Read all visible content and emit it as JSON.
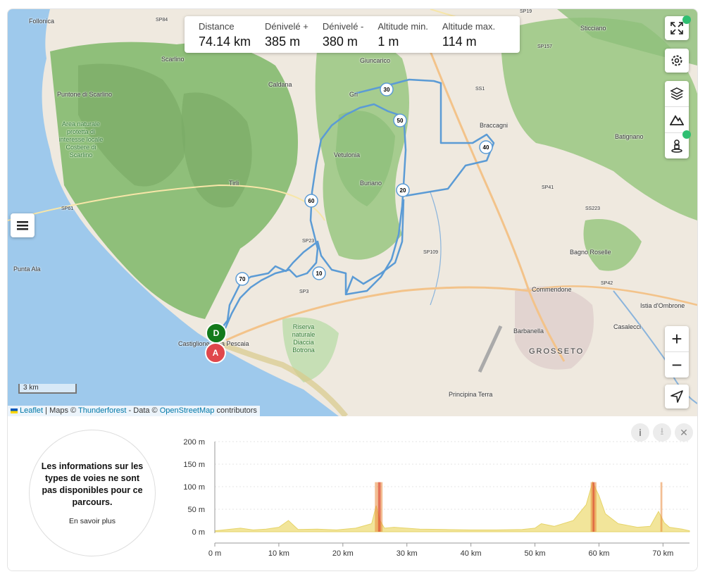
{
  "stats": [
    {
      "label": "Distance",
      "value": "74.14 km"
    },
    {
      "label": "Dénivelé +",
      "value": "385 m"
    },
    {
      "label": "Dénivelé -",
      "value": "380 m"
    },
    {
      "label": "Altitude min.",
      "value": "1 m"
    },
    {
      "label": "Altitude max.",
      "value": "114 m"
    }
  ],
  "places": {
    "follonica": "Follonica",
    "scarlino": "Scarlino",
    "puntone": "Puntone di Scarlino",
    "area_naturale": "Area naturale protetta di interesse locale Costiere di Scarlino",
    "caldana": "Caldana",
    "giuncarico": "Giuncarico",
    "gri": "Gri",
    "vetulonia": "Vetulonia",
    "tirli": "Tirli",
    "buriano": "Buriano",
    "braccagni": "Braccagni",
    "sticciano": "Sticciano",
    "batignano": "Batignano",
    "punta_ala": "Punta Ala",
    "castiglione": "Castiglione della Pescaia",
    "riserva": "Riserva naturale Diaccia Botrona",
    "bagno_roselle": "Bagno Roselle",
    "commendone": "Commendone",
    "istia": "Istia d'Ombrone",
    "barbanella": "Barbanella",
    "casalecci": "Casalecci",
    "grosseto": "GROSSETO",
    "principina": "Principina Terra",
    "sp84": "SP84",
    "sp19": "SP19",
    "sp157": "SP157",
    "ss1": "SS1",
    "sp61": "SP61",
    "sp3": "SP3",
    "sp109": "SP109",
    "sp41": "SP41",
    "ss223": "SS223",
    "sp42": "SP42",
    "sp23": "SP23"
  },
  "markers": {
    "start": "D",
    "end": "A",
    "km": [
      "10",
      "20",
      "30",
      "40",
      "50",
      "60",
      "70"
    ]
  },
  "scale_label": "3 km",
  "attribution": {
    "leaflet": "Leaflet",
    "maps": "| Maps ©",
    "thunderforest": "Thunderforest",
    "data": "- Data ©",
    "osm": "OpenStreetMap",
    "contrib": "contributors"
  },
  "info": {
    "message": "Les informations sur les types de voies ne sont pas disponibles pour ce parcours.",
    "link": "En savoir plus"
  },
  "chart_data": {
    "type": "area",
    "title": "",
    "xlabel": "",
    "ylabel": "",
    "x_ticks": [
      "0 m",
      "10 km",
      "20 km",
      "30 km",
      "40 km",
      "50 km",
      "60 km",
      "70 km"
    ],
    "y_ticks": [
      "200 m",
      "150 m",
      "100 m",
      "50 m",
      "0 m"
    ],
    "xlim": [
      0,
      74.14
    ],
    "ylim": [
      0,
      200
    ],
    "x": [
      0,
      2,
      4,
      6,
      8,
      10,
      11.5,
      13,
      16,
      19,
      22,
      24.5,
      25.2,
      25.8,
      26.5,
      28,
      32,
      36,
      40,
      44,
      48,
      50,
      51,
      53,
      56,
      58,
      59,
      60,
      61,
      63,
      66,
      68,
      69.3,
      70.2,
      71,
      73,
      74.14
    ],
    "y": [
      2,
      5,
      8,
      4,
      6,
      10,
      25,
      5,
      6,
      4,
      8,
      18,
      58,
      25,
      8,
      10,
      6,
      5,
      4,
      4,
      5,
      8,
      18,
      12,
      25,
      60,
      110,
      80,
      40,
      18,
      10,
      12,
      45,
      20,
      10,
      6,
      2
    ]
  }
}
